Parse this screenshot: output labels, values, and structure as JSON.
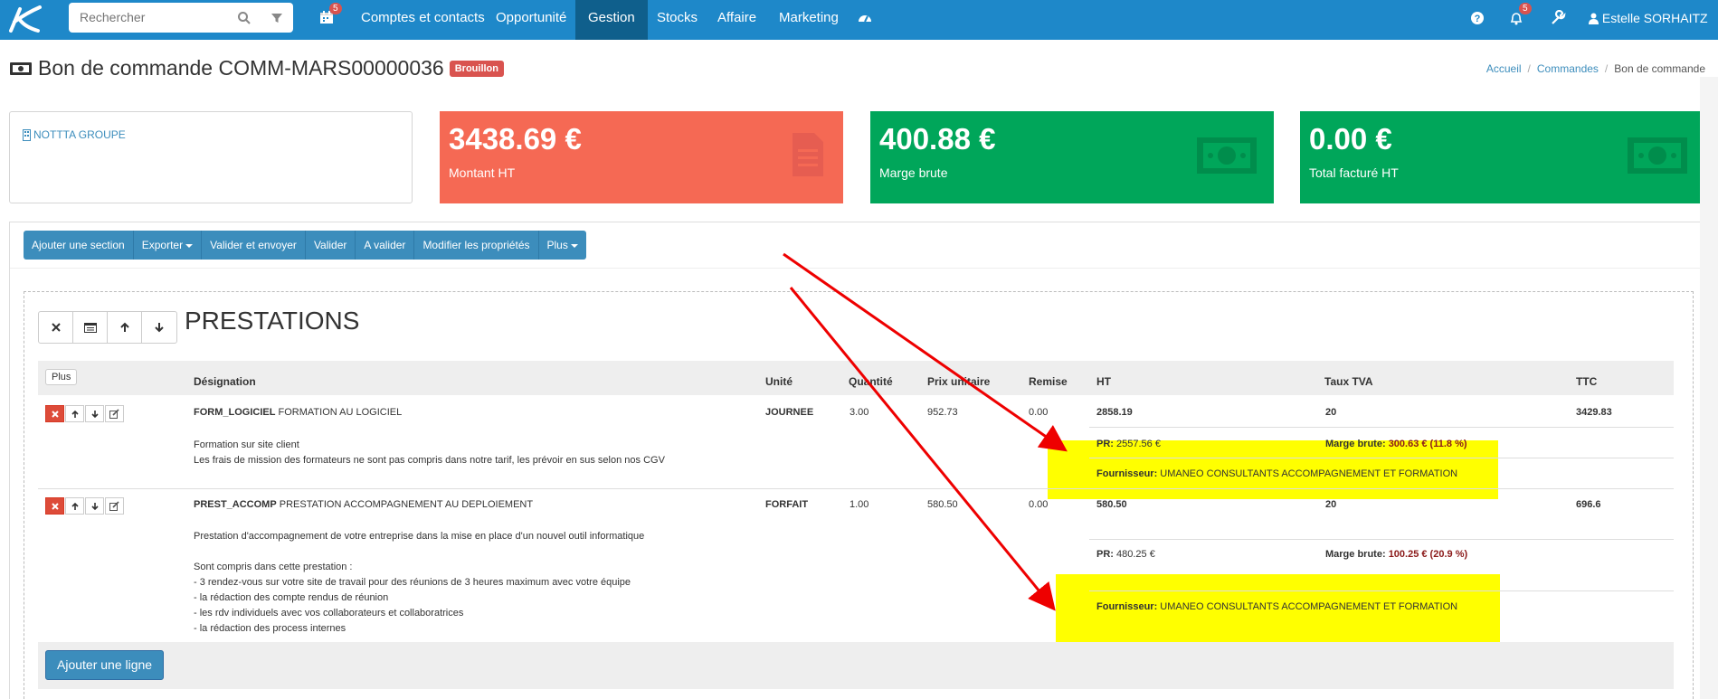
{
  "search": {
    "placeholder": "Rechercher"
  },
  "nav": {
    "calendar_badge": "5",
    "items": [
      "Comptes et contacts",
      "Opportunité",
      "Gestion",
      "Stocks",
      "Affaire",
      "Marketing"
    ],
    "active": "Gestion"
  },
  "topright": {
    "notif_badge": "5",
    "user": "Estelle SORHAITZ"
  },
  "page": {
    "title": "Bon de commande COMM-MARS00000036",
    "status": "Brouillon"
  },
  "breadcrumb": [
    "Accueil",
    "Commandes",
    "Bon de commande"
  ],
  "client": {
    "name": "NOTTTA GROUPE"
  },
  "kpis": [
    {
      "value": "3438.69 €",
      "label": "Montant HT",
      "color": "#f56954"
    },
    {
      "value": "400.88 €",
      "label": "Marge brute",
      "color": "#00a65a"
    },
    {
      "value": "0.00 €",
      "label": "Total facturé HT",
      "color": "#00a65a"
    }
  ],
  "toolbar": {
    "add_section": "Ajouter une section",
    "export": "Exporter",
    "validate_send": "Valider et envoyer",
    "validate": "Valider",
    "to_validate": "A valider",
    "edit_props": "Modifier les propriétés",
    "more": "Plus"
  },
  "section": {
    "title": "PRESTATIONS",
    "more_btn": "Plus"
  },
  "columns": {
    "designation": "Désignation",
    "unit": "Unité",
    "qty": "Quantité",
    "unit_price": "Prix unitaire",
    "discount": "Remise",
    "ht": "HT",
    "vat": "Taux TVA",
    "ttc": "TTC"
  },
  "rows": [
    {
      "code": "FORM_LOGICIEL",
      "label": "FORMATION AU LOGICIEL",
      "unit": "JOURNEE",
      "qty": "3.00",
      "price": "952.73",
      "discount": "0.00",
      "ht": "2858.19",
      "vat": "20",
      "ttc": "3429.83",
      "desc": [
        "Formation sur site client",
        "Les frais de mission des formateurs ne sont pas compris dans notre tarif, les prévoir en sus selon nos CGV"
      ],
      "pr_label": "PR:",
      "pr": "2557.56 €",
      "margin_label": "Marge brute:",
      "margin": "300.63 € (11.8 %)",
      "supplier_label": "Fournisseur:",
      "supplier": "UMANEO CONSULTANTS ACCOMPAGNEMENT ET FORMATION"
    },
    {
      "code": "PREST_ACCOMP",
      "label": "PRESTATION ACCOMPAGNEMENT AU DEPLOIEMENT",
      "unit": "FORFAIT",
      "qty": "1.00",
      "price": "580.50",
      "discount": "0.00",
      "ht": "580.50",
      "vat": "20",
      "ttc": "696.6",
      "desc": [
        "Prestation d'accompagnement de votre entreprise dans la mise en place d'un nouvel outil informatique",
        "",
        "Sont compris dans cette prestation :",
        "- 3 rendez-vous sur votre site de travail pour des réunions de 3 heures maximum avec votre équipe",
        "- la rédaction des compte rendus de réunion",
        "- les rdv individuels avec vos collaborateurs et collaboratrices",
        "- la rédaction des process internes"
      ],
      "pr_label": "PR:",
      "pr": "480.25 €",
      "margin_label": "Marge brute:",
      "margin": "100.25 € (20.9 %)",
      "supplier_label": "Fournisseur:",
      "supplier": "UMANEO CONSULTANTS ACCOMPAGNEMENT ET FORMATION"
    }
  ],
  "add_line": "Ajouter une ligne"
}
